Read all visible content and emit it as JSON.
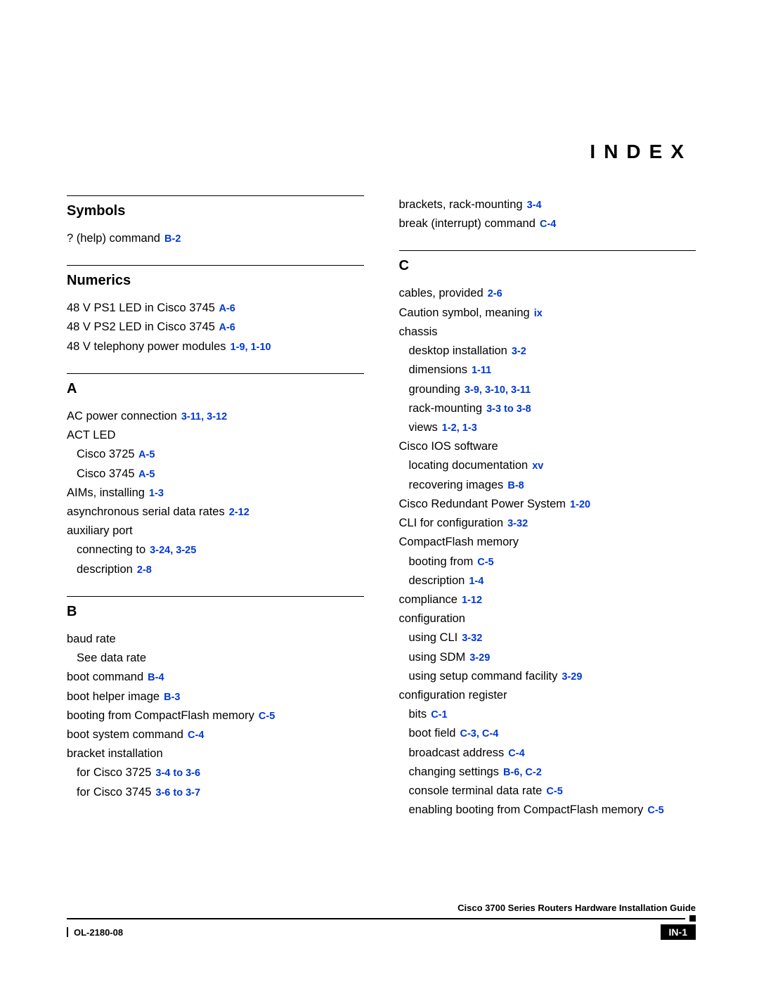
{
  "page_title": "INDEX",
  "footer": {
    "guide": "Cisco 3700 Series Routers Hardware Installation Guide",
    "doc_id": "OL-2180-08",
    "page_num": "IN-1"
  },
  "left": {
    "sections": [
      {
        "heading": "Symbols",
        "entries": [
          {
            "text": "? (help) command",
            "refs": "B-2",
            "indent": 0
          }
        ]
      },
      {
        "heading": "Numerics",
        "entries": [
          {
            "text": "48 V PS1 LED in Cisco 3745",
            "refs": "A-6",
            "indent": 0
          },
          {
            "text": "48 V PS2 LED in Cisco 3745",
            "refs": "A-6",
            "indent": 0
          },
          {
            "text": "48 V telephony power modules",
            "refs": "1-9, 1-10",
            "indent": 0
          }
        ]
      },
      {
        "heading": "A",
        "entries": [
          {
            "text": "AC power connection",
            "refs": "3-11, 3-12",
            "indent": 0
          },
          {
            "text": "ACT LED",
            "refs": "",
            "indent": 0
          },
          {
            "text": "Cisco 3725",
            "refs": "A-5",
            "indent": 1
          },
          {
            "text": "Cisco 3745",
            "refs": "A-5",
            "indent": 1
          },
          {
            "text": "AIMs, installing",
            "refs": "1-3",
            "indent": 0
          },
          {
            "text": "asynchronous serial data rates",
            "refs": "2-12",
            "indent": 0
          },
          {
            "text": "auxiliary port",
            "refs": "",
            "indent": 0
          },
          {
            "text": "connecting to",
            "refs": "3-24, 3-25",
            "indent": 1
          },
          {
            "text": "description",
            "refs": "2-8",
            "indent": 1
          }
        ]
      },
      {
        "heading": "B",
        "entries": [
          {
            "text": "baud rate",
            "refs": "",
            "indent": 0
          },
          {
            "text": "See data rate",
            "refs": "",
            "indent": 1
          },
          {
            "text": "boot command",
            "refs": "B-4",
            "indent": 0
          },
          {
            "text": "boot helper image",
            "refs": "B-3",
            "indent": 0
          },
          {
            "text": "booting from CompactFlash memory",
            "refs": "C-5",
            "indent": 0
          },
          {
            "text": "boot system command",
            "refs": "C-4",
            "indent": 0
          },
          {
            "text": "bracket installation",
            "refs": "",
            "indent": 0
          },
          {
            "text": "for Cisco 3725",
            "refs": "3-4 to 3-6",
            "indent": 1
          },
          {
            "text": "for Cisco 3745",
            "refs": "3-6 to 3-7",
            "indent": 1
          }
        ]
      }
    ]
  },
  "right": {
    "top_entries": [
      {
        "text": "brackets, rack-mounting",
        "refs": "3-4",
        "indent": 0
      },
      {
        "text": "break (interrupt) command",
        "refs": "C-4",
        "indent": 0
      }
    ],
    "sections": [
      {
        "heading": "C",
        "entries": [
          {
            "text": "cables, provided",
            "refs": "2-6",
            "indent": 0
          },
          {
            "text": "Caution symbol, meaning",
            "refs": "ix",
            "indent": 0
          },
          {
            "text": "chassis",
            "refs": "",
            "indent": 0
          },
          {
            "text": "desktop installation",
            "refs": "3-2",
            "indent": 1
          },
          {
            "text": "dimensions",
            "refs": "1-11",
            "indent": 1
          },
          {
            "text": "grounding",
            "refs": "3-9, 3-10, 3-11",
            "indent": 1
          },
          {
            "text": "rack-mounting",
            "refs": "3-3 to 3-8",
            "indent": 1
          },
          {
            "text": "views",
            "refs": "1-2, 1-3",
            "indent": 1
          },
          {
            "text": "Cisco IOS software",
            "refs": "",
            "indent": 0
          },
          {
            "text": "locating documentation",
            "refs": "xv",
            "indent": 1
          },
          {
            "text": "recovering images",
            "refs": "B-8",
            "indent": 1
          },
          {
            "text": "Cisco Redundant Power System",
            "refs": "1-20",
            "indent": 0
          },
          {
            "text": "CLI for configuration",
            "refs": "3-32",
            "indent": 0
          },
          {
            "text": "CompactFlash memory",
            "refs": "",
            "indent": 0
          },
          {
            "text": "booting from",
            "refs": "C-5",
            "indent": 1
          },
          {
            "text": "description",
            "refs": "1-4",
            "indent": 1
          },
          {
            "text": "compliance",
            "refs": "1-12",
            "indent": 0
          },
          {
            "text": "configuration",
            "refs": "",
            "indent": 0
          },
          {
            "text": "using CLI",
            "refs": "3-32",
            "indent": 1
          },
          {
            "text": "using SDM",
            "refs": "3-29",
            "indent": 1
          },
          {
            "text": "using setup command facility",
            "refs": "3-29",
            "indent": 1
          },
          {
            "text": "configuration register",
            "refs": "",
            "indent": 0
          },
          {
            "text": "bits",
            "refs": "C-1",
            "indent": 1
          },
          {
            "text": "boot field",
            "refs": "C-3, C-4",
            "indent": 1
          },
          {
            "text": "broadcast address",
            "refs": "C-4",
            "indent": 1
          },
          {
            "text": "changing settings",
            "refs": "B-6, C-2",
            "indent": 1
          },
          {
            "text": "console terminal data rate",
            "refs": "C-5",
            "indent": 1
          },
          {
            "text": "enabling booting from CompactFlash memory",
            "refs": "C-5",
            "indent": 1
          }
        ]
      }
    ]
  }
}
